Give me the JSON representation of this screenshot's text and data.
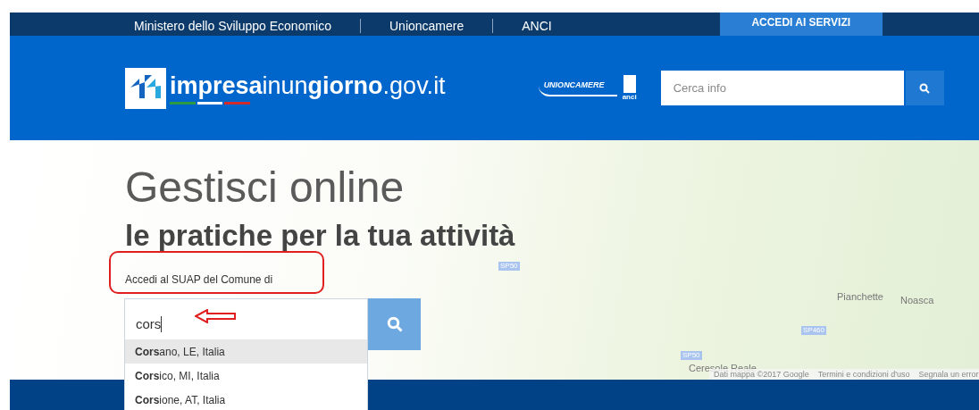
{
  "top_bar": {
    "links": [
      "Ministero dello Sviluppo Economico",
      "Unioncamere",
      "ANCI"
    ],
    "cta": "ACCEDI AI SERVIZI"
  },
  "header": {
    "logo_text": "**impresa**inun**giorno**.gov.it",
    "partner_logo": "UNIONCAMERE",
    "partner_logo_small": "anci",
    "search": {
      "placeholder": "Cerca info"
    }
  },
  "hero": {
    "title": "Gestisci online",
    "subtitle": "le pratiche per la tua attività",
    "field_label": "Accedi al SUAP del Comune di",
    "field_value": "cors",
    "suggestions": [
      {
        "text": "**Cors**ano, LE, Italia",
        "selected": true
      },
      {
        "text": "**Cors**ico, MI, Italia",
        "selected": false
      },
      {
        "text": "**Cors**ione, AT, Italia",
        "selected": false
      }
    ]
  },
  "map": {
    "labels": [
      {
        "text": "SP50",
        "kind": "road"
      },
      {
        "text": "Pianchette",
        "kind": "place"
      },
      {
        "text": "Noasca",
        "kind": "place"
      },
      {
        "text": "SP460",
        "kind": "road"
      },
      {
        "text": "SP50",
        "kind": "road"
      },
      {
        "text": "Ceresole Reale",
        "kind": "place"
      }
    ],
    "attribution": [
      "Dati mappa ©2017 Google",
      "Termini e condizioni d'uso",
      "Segnala un error"
    ]
  }
}
